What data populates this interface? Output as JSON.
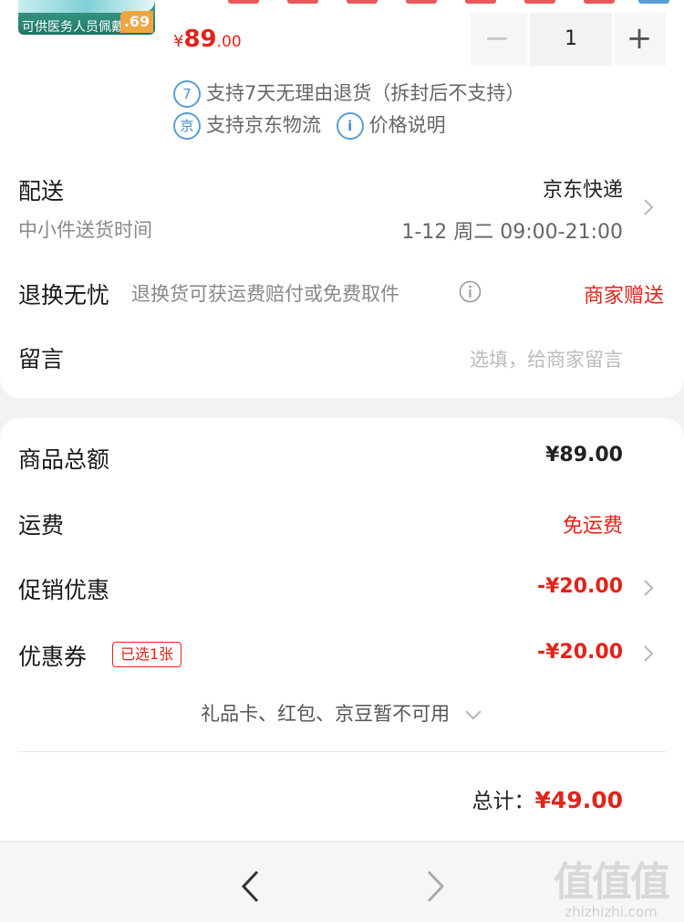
{
  "product": {
    "thumb_text": "可供医务人员佩戴",
    "thumb_badge": ".69",
    "price_symbol": "¥",
    "price_int": "89",
    "price_dec": ".00",
    "quantity": "1",
    "minus_label": "−",
    "plus_label": "+"
  },
  "tags": {
    "return_icon": "7",
    "return_text": "支持7天无理由退货（拆封后不支持）",
    "jd_icon": "京",
    "jd_text": "支持京东物流",
    "info_icon": "i",
    "price_note": "价格说明"
  },
  "delivery": {
    "label": "配送",
    "method": "京东快递",
    "sub_label": "中小件送货时间",
    "time": "1-12 周二 09:00-21:00"
  },
  "returns": {
    "label": "退换无忧",
    "desc": "退换货可获运费赔付或免费取件",
    "badge": "商家赠送"
  },
  "message": {
    "label": "留言",
    "placeholder": "选填，给商家留言"
  },
  "summary": {
    "goods_label": "商品总额",
    "goods_value": "¥89.00",
    "shipping_label": "运费",
    "shipping_value": "免运费",
    "promo_label": "促销优惠",
    "promo_value": "-¥20.00",
    "coupon_label": "优惠券",
    "coupon_badge": "已选1张",
    "coupon_value": "-¥20.00",
    "giftcard_text": "礼品卡、红包、京豆暂不可用",
    "total_label": "总计：",
    "total_value": "¥49.00"
  },
  "watermark": {
    "logo": "值值值",
    "domain": "zhizhizhi.com"
  },
  "colors": {
    "accent_red": "#e2231a",
    "tag_blue": "#4a8fcb"
  }
}
